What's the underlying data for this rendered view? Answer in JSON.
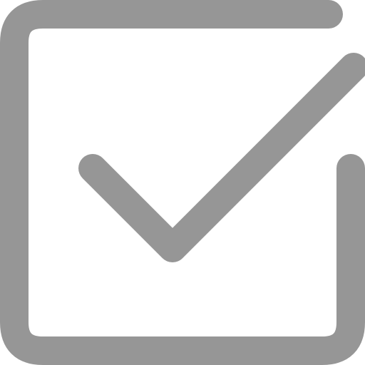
{
  "icon": {
    "name": "checkbox-checked-icon",
    "color": "#969696",
    "background": "#ffffff"
  }
}
